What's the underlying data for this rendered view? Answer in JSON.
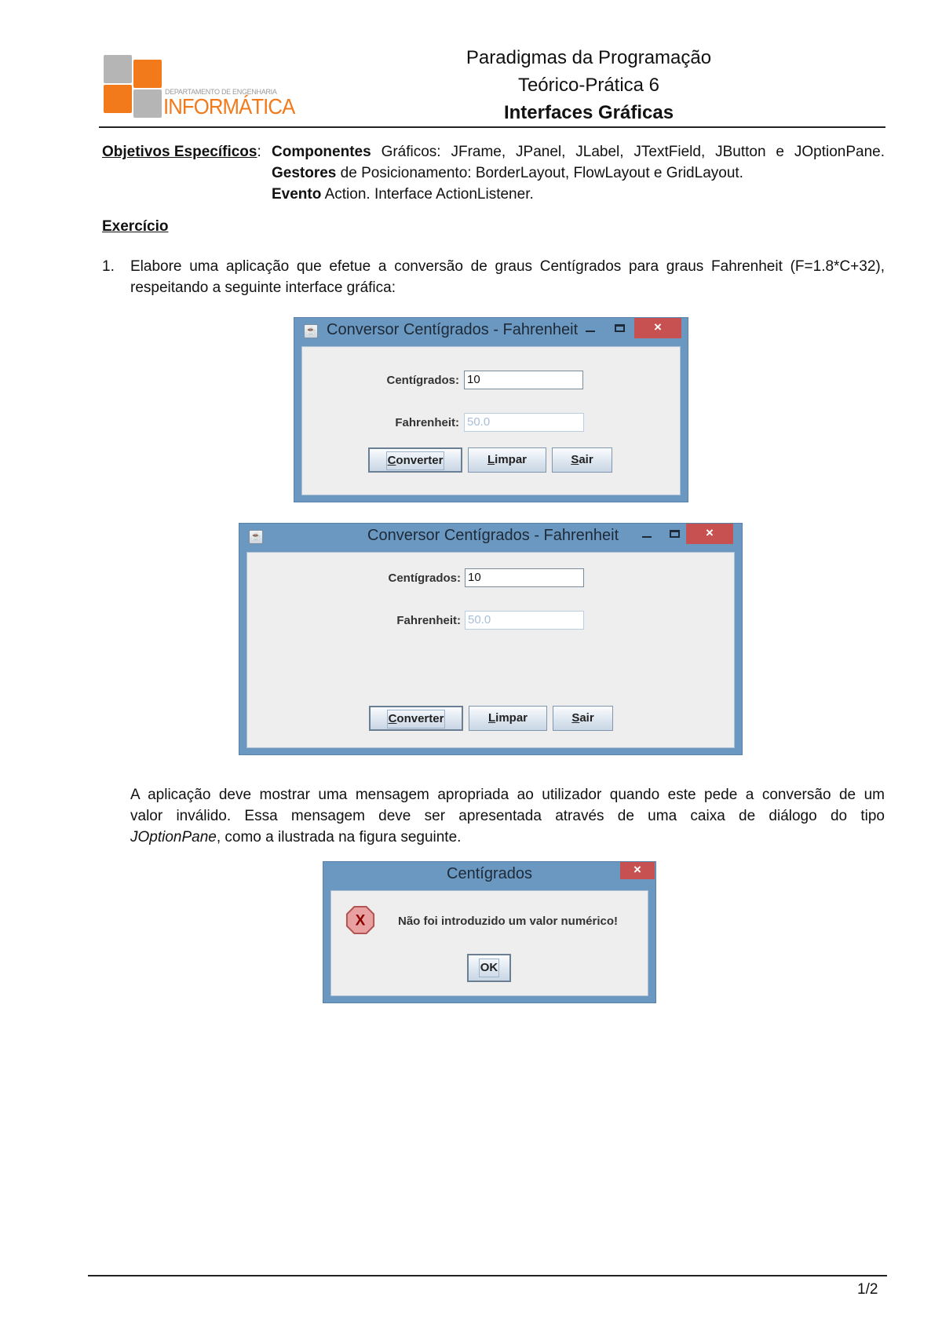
{
  "header": {
    "logo": {
      "subtitle": "DEPARTAMENTO DE ENGENHARIA",
      "name": "INFORMÁTICA",
      "colors": {
        "orange": "#f27a1a",
        "gray": "#b5b5b5"
      }
    },
    "course": "Paradigmas da Programação",
    "session": "Teórico-Prática 6",
    "topic": "Interfaces Gráficas"
  },
  "objectives": {
    "label": "Objetivos Específicos",
    "label_suffix": ":",
    "lines": [
      {
        "bold": "Componentes",
        "text": " Gráficos: JFrame, JPanel, JLabel, JTextField, JButton e JOptionPane."
      },
      {
        "bold": "Gestores",
        "text": " de Posicionamento: BorderLayout, FlowLayout e GridLayout."
      },
      {
        "bold": "Evento",
        "text": " Action. Interface ActionListener."
      }
    ]
  },
  "exercise": {
    "heading": "Exercício",
    "item_number": "1.",
    "item_line1": "Elabore uma aplicação que efetue a conversão de graus Centígrados para graus Fahrenheit (F=1.8*C+32),",
    "item_line2": "respeitando a seguinte interface gráfica:",
    "paragraph_line1": "A aplicação deve mostrar uma mensagem apropriada ao utilizador quando este pede a conversão de um",
    "paragraph_line2": "valor inválido. Essa mensagem deve ser apresentada através de uma caixa de diálogo do tipo",
    "paragraph_line3_italic": "JOptionPane",
    "paragraph_line3_rest": ", como a ilustrada na figura seguinte."
  },
  "window": {
    "title": "Conversor Centígrados - Fahrenheit",
    "icon": "java-coffee-icon",
    "controls": {
      "minimize": "–",
      "maximize": "□",
      "close": "×"
    },
    "celsius_label": "Centígrados:",
    "celsius_value": "10",
    "fahrenheit_label": "Fahrenheit:",
    "fahrenheit_value": "50.0",
    "buttons": [
      {
        "mnemonic": "C",
        "rest": "onverter"
      },
      {
        "mnemonic": "L",
        "rest": "impar"
      },
      {
        "mnemonic": "S",
        "rest": "air"
      }
    ],
    "colors": {
      "frame": "#6b98c0",
      "close": "#c75050",
      "panel": "#eeeeee"
    }
  },
  "dialog": {
    "title": "Centígrados",
    "close": "×",
    "icon": "error-icon",
    "message": "Não foi introduzido um valor numérico!",
    "ok_label": "OK"
  },
  "footer": {
    "page": "1/2"
  }
}
